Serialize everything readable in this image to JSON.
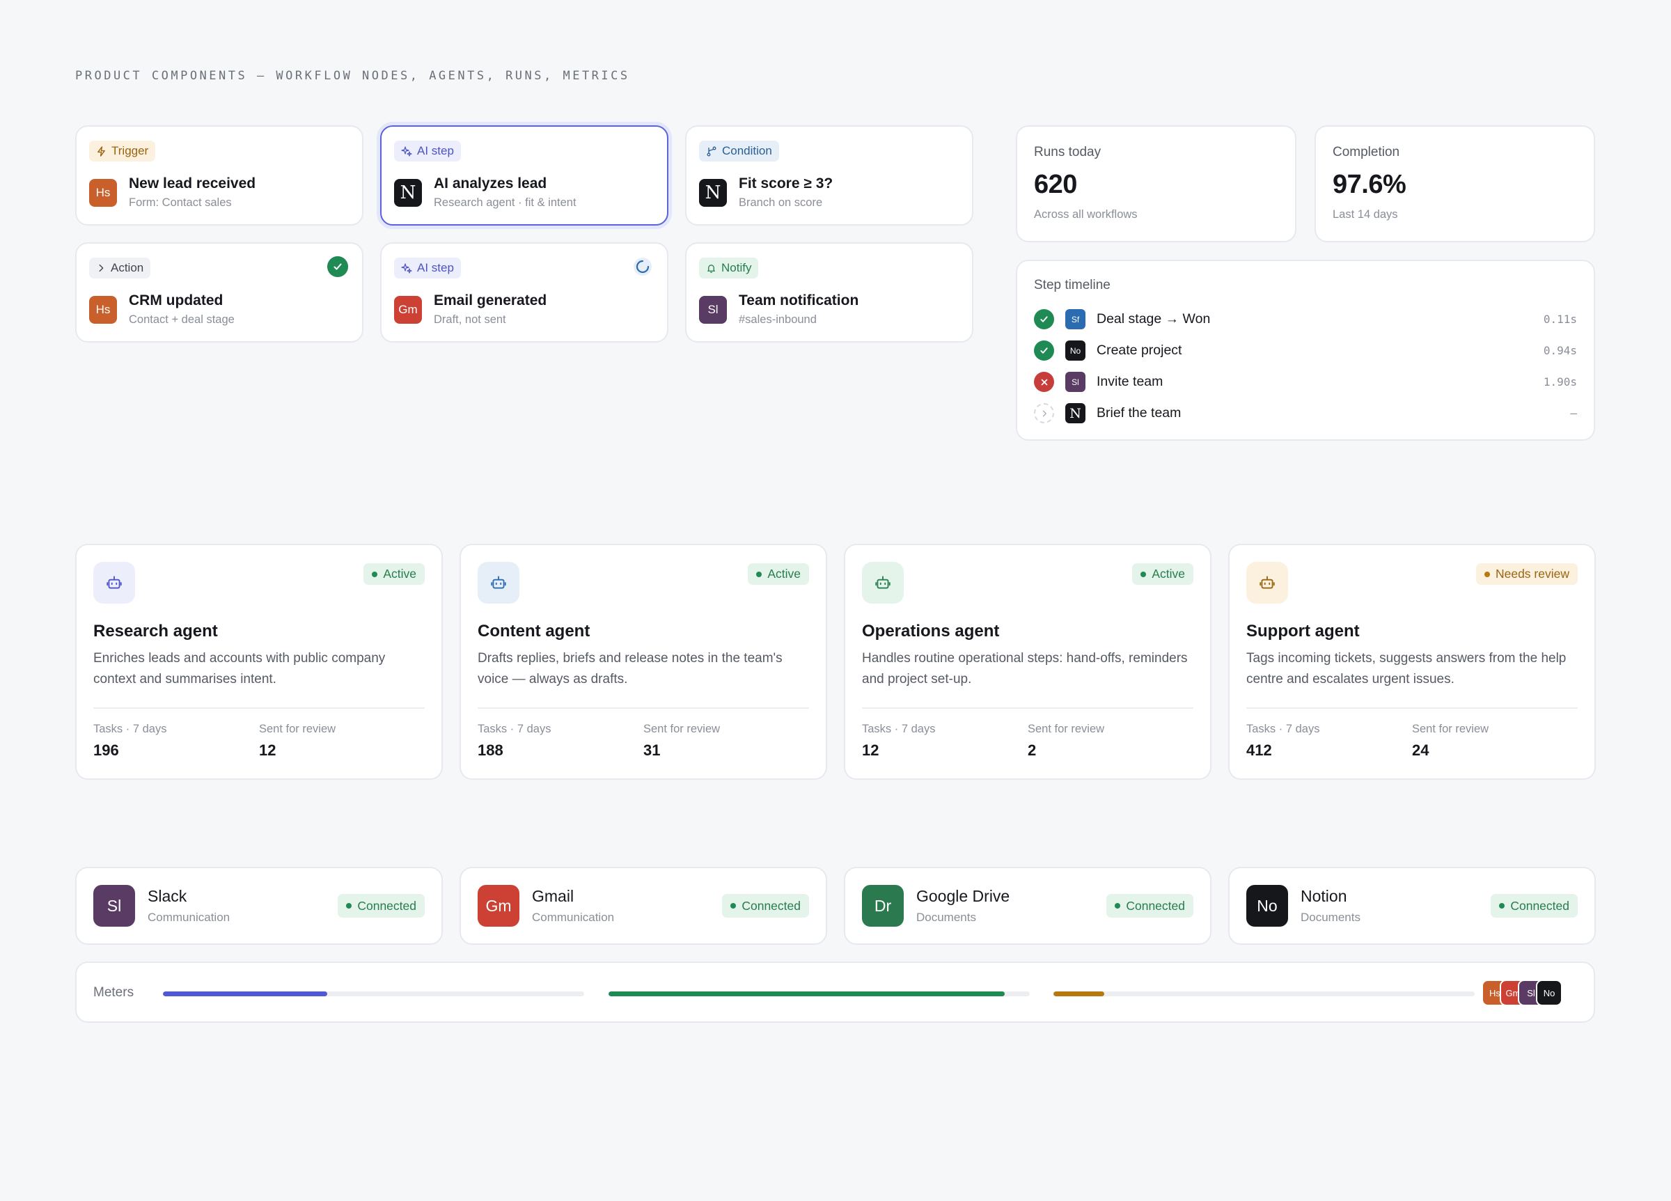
{
  "page_heading": "PRODUCT COMPONENTS — WORKFLOW NODES, AGENTS, RUNS, METRICS",
  "nodes": [
    {
      "tag": "Trigger",
      "logo": "Hs",
      "title": "New lead received",
      "subtitle": "Form: Contact sales"
    },
    {
      "tag": "AI step",
      "logo": "N",
      "title": "AI analyzes lead",
      "subtitle": "Research agent · fit & intent"
    },
    {
      "tag": "Condition",
      "logo": "N",
      "title": "Fit score ≥ 3?",
      "subtitle": "Branch on score"
    },
    {
      "tag": "Action",
      "logo": "Hs",
      "title": "CRM updated",
      "subtitle": "Contact + deal stage"
    },
    {
      "tag": "AI step",
      "logo": "Gm",
      "title": "Email generated",
      "subtitle": "Draft, not sent"
    },
    {
      "tag": "Notify",
      "logo": "Sl",
      "title": "Team notification",
      "subtitle": "#sales-inbound"
    }
  ],
  "metrics": [
    {
      "label": "Runs today",
      "value": "620",
      "sub": "Across all workflows"
    },
    {
      "label": "Completion",
      "value": "97.6%",
      "sub": "Last 14 days"
    }
  ],
  "timeline": {
    "title": "Step timeline",
    "steps": [
      {
        "logo": "Sf",
        "name": "Deal stage → Won",
        "time": "0.11s",
        "status": "success"
      },
      {
        "logo": "No",
        "name": "Create project",
        "time": "0.94s",
        "status": "success"
      },
      {
        "logo": "Sl",
        "name": "Invite team",
        "time": "1.90s",
        "status": "failed"
      },
      {
        "logo": "N",
        "name": "Brief the team",
        "time": "–",
        "status": "pending"
      }
    ]
  },
  "agents": [
    {
      "name": "Research agent",
      "badge": "Active",
      "description": "Enriches leads and accounts with public company context and summarises intent.",
      "tasks_label": "Tasks · 7 days",
      "tasks": "196",
      "review_label": "Sent for review",
      "review": "12"
    },
    {
      "name": "Content agent",
      "badge": "Active",
      "description": "Drafts replies, briefs and release notes in the team's voice — always as drafts.",
      "tasks_label": "Tasks · 7 days",
      "tasks": "188",
      "review_label": "Sent for review",
      "review": "31"
    },
    {
      "name": "Operations agent",
      "badge": "Active",
      "description": "Handles routine operational steps: hand-offs, reminders and project set-up.",
      "tasks_label": "Tasks · 7 days",
      "tasks": "12",
      "review_label": "Sent for review",
      "review": "2"
    },
    {
      "name": "Support agent",
      "badge": "Needs review",
      "description": "Tags incoming tickets, suggests answers from the help centre and escalates urgent issues.",
      "tasks_label": "Tasks · 7 days",
      "tasks": "412",
      "review_label": "Sent for review",
      "review": "24"
    }
  ],
  "integrations": [
    {
      "logo": "Sl",
      "name": "Slack",
      "category": "Communication",
      "status": "Connected"
    },
    {
      "logo": "Gm",
      "name": "Gmail",
      "category": "Communication",
      "status": "Connected"
    },
    {
      "logo": "Dr",
      "name": "Google Drive",
      "category": "Documents",
      "status": "Connected"
    },
    {
      "logo": "No",
      "name": "Notion",
      "category": "Documents",
      "status": "Connected"
    }
  ],
  "meters": {
    "label": "Meters",
    "values": [
      0.39,
      0.94,
      0.12
    ],
    "colors": [
      "#5258d4",
      "#1f8a53",
      "#b7780f"
    ],
    "avatars": [
      "Hs",
      "Gm",
      "Sl",
      "No"
    ]
  },
  "colors": {
    "accent": "#5b63d9",
    "success": "#1f8a53",
    "warning": "#b7780f",
    "danger": "#c63d3a",
    "hubspot": "#c9602b",
    "gmail": "#cc4133",
    "slack": "#5a3b64",
    "drive": "#2b7a4f",
    "notion": "#16171b"
  }
}
